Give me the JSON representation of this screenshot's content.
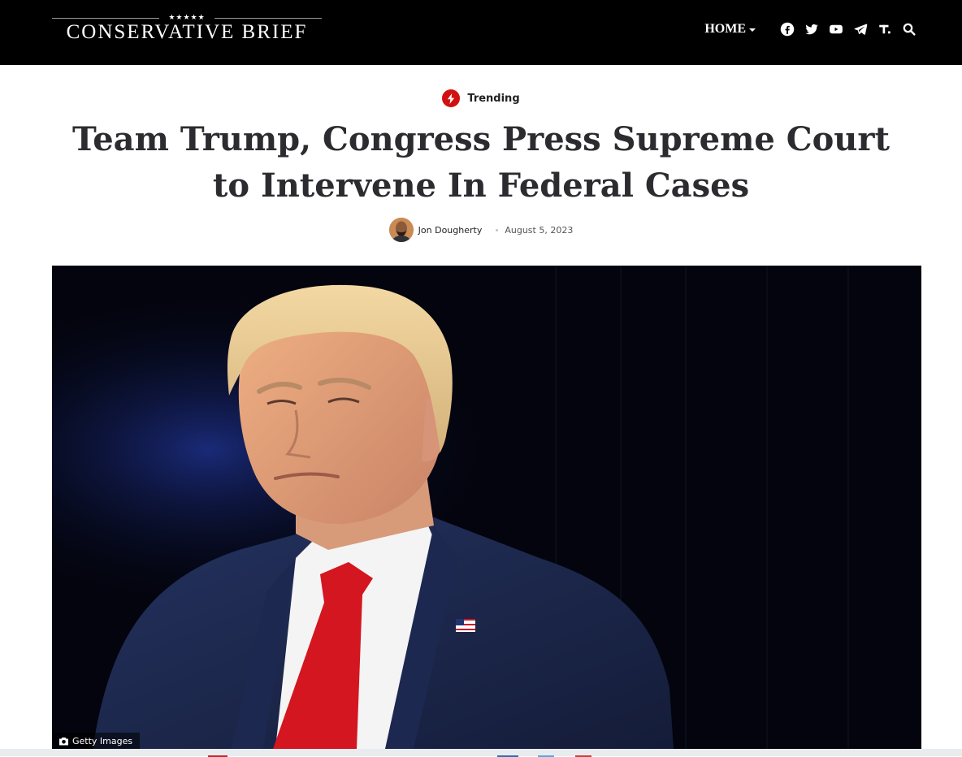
{
  "site": {
    "logo_text": "CONSERVATIVE BRIEF",
    "logo_stars": "★★★★★"
  },
  "nav": {
    "home_label": "HOME",
    "icons": [
      "facebook-icon",
      "twitter-icon",
      "youtube-icon",
      "telegram-icon",
      "truth-social-icon",
      "search-icon"
    ]
  },
  "article": {
    "category": "Trending",
    "title": "Team Trump, Congress Press Supreme Court to Intervene In Federal Cases",
    "author": "Jon Dougherty",
    "date": "August 5, 2023",
    "image_credit": "Getty Images"
  },
  "colors": {
    "header_bg": "#000000",
    "accent_red": "#d21010",
    "headline": "#2b2b30"
  }
}
